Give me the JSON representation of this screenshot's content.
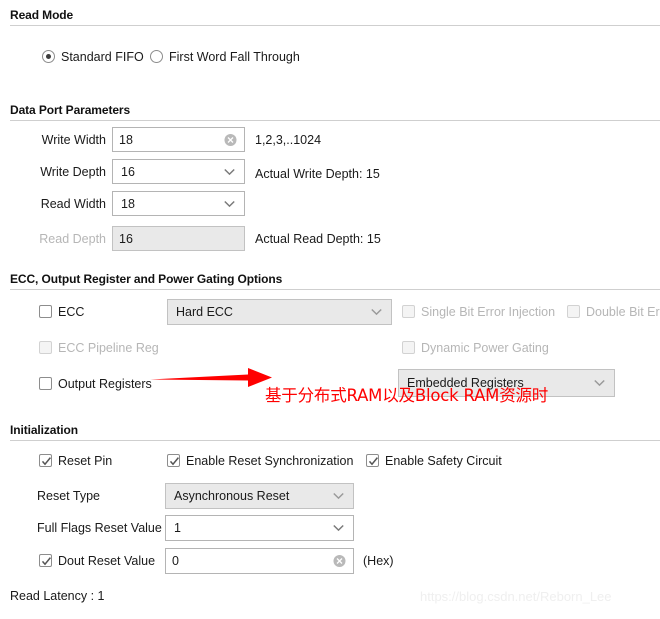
{
  "sections": [
    {
      "title": "Read Mode"
    },
    {
      "title": "Data Port Parameters"
    },
    {
      "title": "ECC, Output Register and Power Gating Options"
    },
    {
      "title": "Initialization"
    }
  ],
  "read_mode": {
    "options": [
      {
        "label": "Standard FIFO",
        "selected": true
      },
      {
        "label": "First Word Fall Through",
        "selected": false
      }
    ]
  },
  "data_port": {
    "write_width": {
      "label": "Write Width",
      "value": "18",
      "hint": "1,2,3,..1024"
    },
    "write_depth": {
      "label": "Write Depth",
      "value": "16",
      "hint": "Actual Write Depth: 15"
    },
    "read_width": {
      "label": "Read Width",
      "value": "18"
    },
    "read_depth": {
      "label": "Read Depth",
      "value": "16",
      "hint": "Actual Read Depth: 15"
    }
  },
  "ecc": {
    "ecc_checkbox": "ECC",
    "ecc_mode_value": "Hard ECC",
    "single_bit_error_injection": "Single Bit Error Injection",
    "double_bit_error_injection": "Double Bit Err",
    "ecc_pipeline_reg": "ECC Pipeline Reg",
    "dynamic_power_gating": "Dynamic Power Gating",
    "output_registers": "Output Registers",
    "output_registers_value": "Embedded Registers"
  },
  "initialization": {
    "reset_pin": "Reset Pin",
    "enable_reset_synchronization": "Enable Reset Synchronization",
    "enable_safety_circuit": "Enable Safety Circuit",
    "reset_type_label": "Reset Type",
    "reset_type_value": "Asynchronous Reset",
    "full_flags_label": "Full Flags Reset Value",
    "full_flags_value": "1",
    "dout_reset_label": "Dout Reset Value",
    "dout_reset_value": "0",
    "dout_hex_suffix": "(Hex)"
  },
  "footer": {
    "read_latency": "Read Latency : 1"
  },
  "annotation": {
    "text": "基于分布式RAM以及Block RAM资源时",
    "color": "#ff0000"
  },
  "watermark": {
    "text": "https://blog.csdn.net/Reborn_Lee"
  }
}
